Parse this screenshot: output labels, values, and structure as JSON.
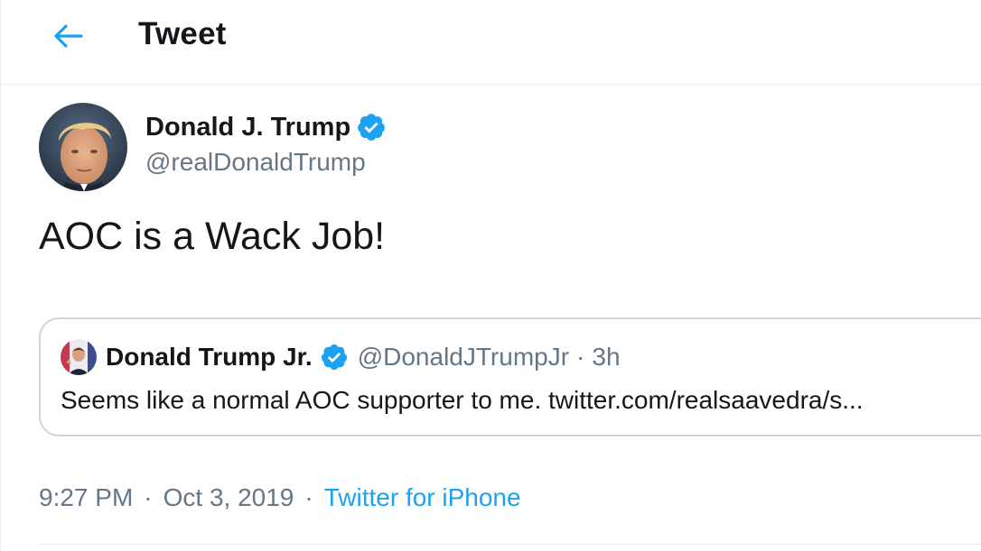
{
  "header": {
    "title": "Tweet",
    "back_icon": "arrow-left-icon"
  },
  "tweet": {
    "author_name": "Donald J. Trump",
    "author_handle": "@realDonaldTrump",
    "text": "AOC is a Wack Job!",
    "time": "9:27 PM",
    "date": "Oct 3, 2019",
    "source": "Twitter for iPhone",
    "separator": "·"
  },
  "quote": {
    "author_name": "Donald Trump Jr.",
    "author_handle": "@DonaldJTrumpJr",
    "separator": "·",
    "time": "3h",
    "text": "Seems like a normal AOC supporter to me. twitter.com/realsaavedra/s..."
  },
  "colors": {
    "accent": "#1da1f2",
    "text": "#14171a",
    "muted": "#657786",
    "border": "#ccd6dd"
  }
}
